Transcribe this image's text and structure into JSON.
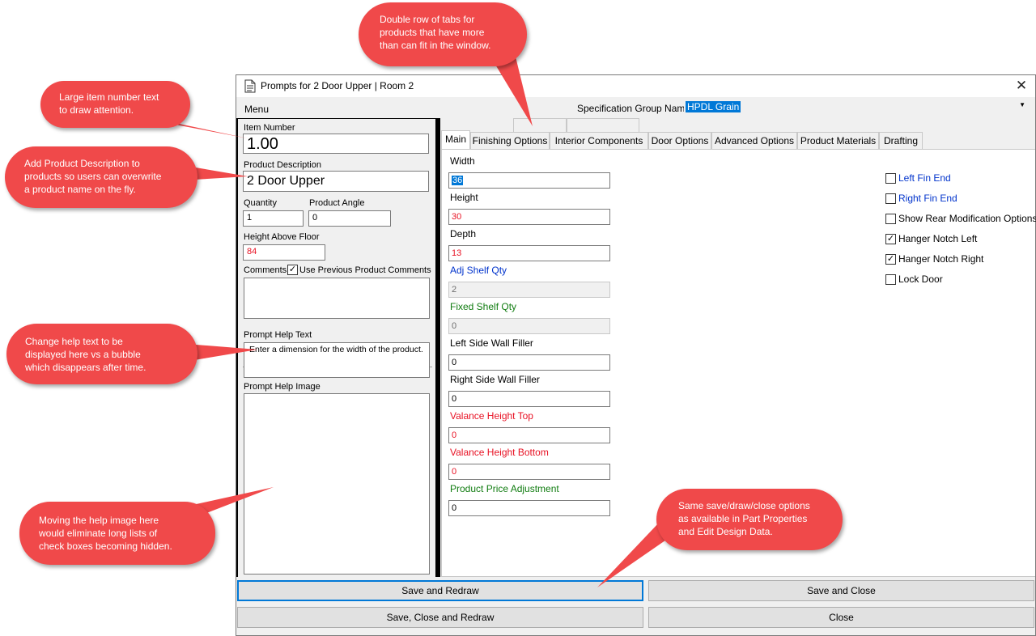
{
  "window": {
    "title": "Prompts for 2 Door Upper | Room 2",
    "close_glyph": "✕"
  },
  "menubar": {
    "menu_label": "Menu",
    "spec_group_label": "Specification Group Name",
    "spec_group_value": "HPDL Grain"
  },
  "left_panel": {
    "item_number_label": "Item Number",
    "item_number_value": "1.00",
    "product_description_label": "Product Description",
    "product_description_value": "2 Door Upper",
    "quantity_label": "Quantity",
    "quantity_value": "1",
    "product_angle_label": "Product Angle",
    "product_angle_value": "0",
    "height_above_floor_label": "Height Above Floor",
    "height_above_floor_value": "84",
    "comments_label": "Comments",
    "use_previous_comments_label": "Use Previous Product Comments",
    "use_previous_comments_checked": true,
    "comments_value": "",
    "prompt_help_text_label": "Prompt Help Text",
    "prompt_help_text_value": "Enter a dimension for the width of the product.",
    "prompt_help_image_label": "Prompt Help Image"
  },
  "tabs": [
    "Main",
    "Finishing Options",
    "Interior Components",
    "Door Options",
    "Advanced Options",
    "Product Materials",
    "Drafting"
  ],
  "active_tab": "Main",
  "main_tab": {
    "fields": [
      {
        "label": "Width",
        "value": "36",
        "label_color": "black",
        "value_color": "selected"
      },
      {
        "label": "Height",
        "value": "30",
        "label_color": "black",
        "value_color": "red"
      },
      {
        "label": "Depth",
        "value": "13",
        "label_color": "black",
        "value_color": "red"
      },
      {
        "label": "Adj Shelf Qty",
        "value": "2",
        "label_color": "blue",
        "value_color": "disabled"
      },
      {
        "label": "Fixed Shelf Qty",
        "value": "0",
        "label_color": "green",
        "value_color": "disabled"
      },
      {
        "label": "Left Side Wall Filler",
        "value": "0",
        "label_color": "black",
        "value_color": "black"
      },
      {
        "label": "Right Side Wall Filler",
        "value": "0",
        "label_color": "black",
        "value_color": "black"
      },
      {
        "label": "Valance Height Top",
        "value": "0",
        "label_color": "red",
        "value_color": "red"
      },
      {
        "label": "Valance Height Bottom",
        "value": "0",
        "label_color": "red",
        "value_color": "red"
      },
      {
        "label": "Product Price Adjustment",
        "value": "0",
        "label_color": "green",
        "value_color": "black"
      }
    ],
    "checkboxes": [
      {
        "label": "Left Fin End",
        "checked": false,
        "label_color": "blue"
      },
      {
        "label": "Right Fin End",
        "checked": false,
        "label_color": "blue"
      },
      {
        "label": "Show Rear Modification Options",
        "checked": false,
        "label_color": "black"
      },
      {
        "label": "Hanger Notch Left",
        "checked": true,
        "label_color": "black"
      },
      {
        "label": "Hanger Notch Right",
        "checked": true,
        "label_color": "black"
      },
      {
        "label": "Lock Door",
        "checked": false,
        "label_color": "black"
      }
    ]
  },
  "buttons": {
    "save_redraw": "Save and Redraw",
    "save_close": "Save and Close",
    "save_close_redraw": "Save, Close and Redraw",
    "close": "Close"
  },
  "callouts": {
    "tabs_note": "Double row of tabs for\nproducts that have more\nthan can fit in the window.",
    "item_number_note": "Large item number text\nto draw attention.",
    "description_note": "Add Product Description to\nproducts so users can overwrite\na product name on the fly.",
    "help_text_note": "Change help text to be\ndisplayed here vs a bubble\nwhich disappears after time.",
    "help_image_note": "Moving the help image here\nwould eliminate long lists of\ncheck boxes becoming hidden.",
    "buttons_note": "Same save/draw/close options\nas available in Part Properties\nand Edit Design Data."
  },
  "colors": {
    "callout_fill": "#f0494a",
    "selection_blue": "#0078d7",
    "label_red": "#e81123",
    "label_blue": "#0033cc",
    "label_green": "#107c10"
  }
}
